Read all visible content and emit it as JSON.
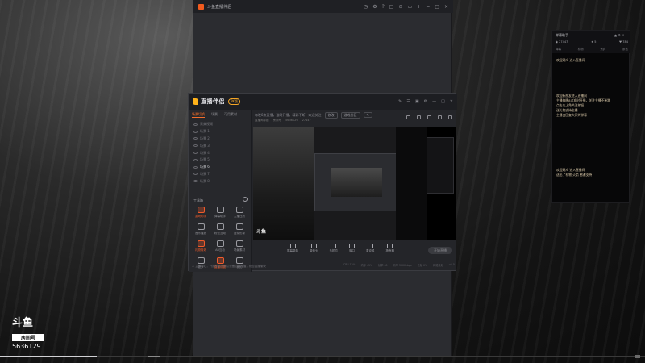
{
  "outer_window": {
    "title": "斗鱼直播伴侣",
    "controls": [
      "◷",
      "⚙",
      "?",
      "□",
      "⊙",
      "▭",
      "+",
      "−",
      "□",
      "×"
    ]
  },
  "app": {
    "title": "直播伴侣",
    "badge": "PK版",
    "header_controls": [
      "✎",
      "☰",
      "▣",
      "⚙",
      "—",
      "□",
      "×"
    ],
    "scene_tabs": [
      "场景切换",
      "场景",
      "可用素材"
    ],
    "scenes": [
      "采集视频",
      "场景 1",
      "场景 2",
      "场景 3",
      "场景 4",
      "场景 5",
      "场景 6",
      "场景 7",
      "场景 8"
    ],
    "selected_scene_index": 6,
    "tools_label": "工具箱",
    "tools": [
      {
        "label": "游戏助手",
        "icon": "game-icon",
        "hot": true
      },
      {
        "label": "弹幕助手",
        "icon": "danmaku-icon",
        "hot": false
      },
      {
        "label": "主播日历",
        "icon": "calendar-icon",
        "hot": false
      },
      {
        "label": "音乐播放",
        "icon": "music-icon",
        "hot": false
      },
      {
        "label": "粉丝互动",
        "icon": "user-icon",
        "hot": false
      },
      {
        "label": "虚拟形象",
        "icon": "avatar-icon",
        "hot": false
      },
      {
        "label": "礼物特效",
        "icon": "gift-icon",
        "hot": true
      },
      {
        "label": "AR互动",
        "icon": "ar-icon",
        "hot": false
      },
      {
        "label": "场景素材",
        "icon": "scene-icon",
        "hot": false
      },
      {
        "label": "更多",
        "icon": "more-icon",
        "hot": false
      },
      {
        "label": "直播设置",
        "icon": "settings-icon",
        "hot": true
      },
      {
        "label": "我的",
        "icon": "profile-icon",
        "hot": false
      }
    ],
    "left_hint": "⚠ 主播中心，开播前请先确认设备后再开播，祝您直播愉快",
    "toolbar_text": "每晚8点直播，准时开播，精彩不断，欢迎关注",
    "toolbar_pills": [
      "修改",
      "游戏分区",
      "✎"
    ],
    "room_row": [
      "直播间标题",
      "房间号",
      "5636129",
      "27447"
    ],
    "preview_watermark": "斗鱼",
    "bottom_tools": [
      "屏幕录制",
      "摄像头",
      "多机位",
      "窗口",
      "麦克风",
      "扬声器"
    ],
    "start_button": "开始直播",
    "status_bar": [
      "CPU 12%",
      "内存 45%",
      "帧率 60",
      "码率 3000kbps",
      "丢帧 0%",
      "网络良好",
      "v3.0"
    ]
  },
  "chat": {
    "title": "弹幕助手",
    "title_controls": "▲ ⚙ ×",
    "stats": [
      "◉ 27447",
      "★ 5",
      "♥ 784"
    ],
    "tabs": [
      "弹幕",
      "礼物",
      "贵宾",
      "禁言"
    ],
    "messages": [
      {
        "lines": [
          "欢迎观众 进入直播间"
        ]
      },
      {
        "lines": [
          "欢迎新朋友进入直播间",
          "主播每晚8点准时开播，关注主播不迷路",
          "点击左上角关注按钮",
          "送礼物支持主播",
          "主播会回复大家的弹幕"
        ]
      },
      {
        "lines": [
          "欢迎观众 进入直播间",
          "送出了礼物 火箭 感谢支持"
        ]
      }
    ]
  },
  "branding": {
    "logo": "斗鱼",
    "room_label": "房间号",
    "room_number": "5636129"
  },
  "progress": {
    "played_fraction": 0.15
  }
}
